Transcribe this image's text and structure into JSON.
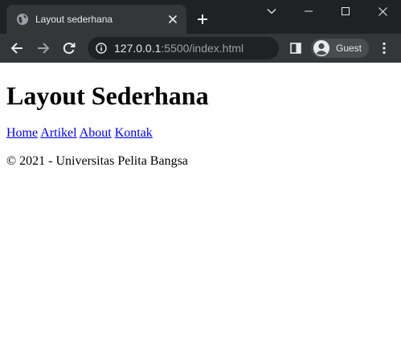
{
  "window": {
    "tab": {
      "title": "Layout sederhana",
      "favicon": "globe-icon"
    },
    "controls": [
      "chevron-down-icon",
      "minimize-icon",
      "maximize-icon",
      "close-icon"
    ]
  },
  "toolbar": {
    "url_host": "127.0.0.1",
    "url_path": ":5500/index.html",
    "profile_label": "Guest"
  },
  "page": {
    "title": "Layout Sederhana",
    "nav": [
      {
        "label": "Home"
      },
      {
        "label": "Artikel"
      },
      {
        "label": "About"
      },
      {
        "label": "Kontak"
      }
    ],
    "footer": "© 2021 - Universitas Pelita Bangsa"
  },
  "colors": {
    "tabstrip_bg": "#202124",
    "toolbar_bg": "#35363a",
    "link": "#0000ee"
  }
}
